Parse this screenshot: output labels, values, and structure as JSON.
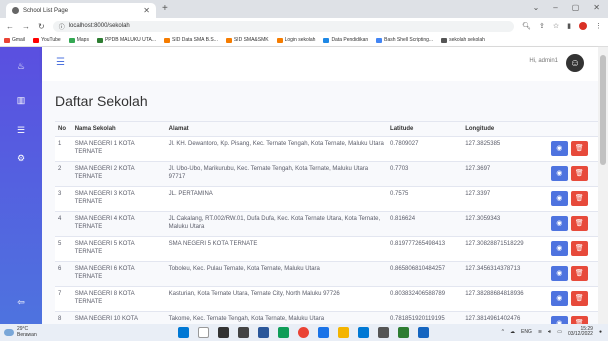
{
  "browser": {
    "tab_title": "School List Page",
    "url": "localhost:8000/sekolah",
    "bookmarks": [
      "Gmail",
      "YouTube",
      "Maps",
      "PPDB MALUKU UTA...",
      "SID Data SMA B.S...",
      "SID SMA&SMK",
      "Login sekolah",
      "Data Pendidikan",
      "Bash Shell Scripting...",
      "sekolah sekolah"
    ]
  },
  "app": {
    "user_name": "Hi, admin1",
    "page_title": "Daftar Sekolah"
  },
  "table": {
    "headers": {
      "no": "No",
      "nama": "Nama Sekolah",
      "alamat": "Alamat",
      "lat": "Latitude",
      "lon": "Longitude"
    },
    "rows": [
      {
        "no": "1",
        "nama": "SMA NEGERI 1 KOTA TERNATE",
        "alamat": "Jl. KH. Dewantoro, Kp. Pisang, Kec. Ternate Tengah, Kota Ternate, Maluku Utara",
        "lat": "0.7809027",
        "lon": "127.3825385"
      },
      {
        "no": "2",
        "nama": "SMA NEGERI 2 KOTA TERNATE",
        "alamat": "Jl. Ubo-Ubo, Marikurubu, Kec. Ternate Tengah, Kota Ternate, Maluku Utara 97717",
        "lat": "0.7703",
        "lon": "127.3697"
      },
      {
        "no": "3",
        "nama": "SMA NEGERI 3 KOTA TERNATE",
        "alamat": "JL. PERTAMINA",
        "lat": "0.7575",
        "lon": "127.3397"
      },
      {
        "no": "4",
        "nama": "SMA NEGERI 4 KOTA TERNATE",
        "alamat": "JL Cakalang, RT.002/RW.01, Dufa Dufa, Kec. Kota Ternate Utara, Kota Ternate, Maluku Utara",
        "lat": "0.816624",
        "lon": "127.3059343"
      },
      {
        "no": "5",
        "nama": "SMA NEGERI 5 KOTA TERNATE",
        "alamat": "SMA NEGERI 5 KOTA TERNATE",
        "lat": "0.819777265498413",
        "lon": "127.30828871518229"
      },
      {
        "no": "6",
        "nama": "SMA NEGERI 6 KOTA TERNATE",
        "alamat": "Toboleu, Kec. Pulau Ternate, Kota Ternate, Maluku Utara",
        "lat": "0.865806810484257",
        "lon": "127.3456314378713"
      },
      {
        "no": "7",
        "nama": "SMA NEGERI 8 KOTA TERNATE",
        "alamat": "Kasturian, Kota Ternate Utara, Ternate City, North Maluku 97726",
        "lat": "0.803832406588789",
        "lon": "127.38288684818936"
      },
      {
        "no": "8",
        "nama": "SMA NEGERI 10 KOTA TERNATE",
        "alamat": "Takome, Kec. Ternate Tengah, Kota Ternate, Maluku Utara",
        "lat": "0.781851920119195",
        "lon": "127.3814961402476"
      }
    ]
  },
  "taskbar": {
    "temperature": "29°C",
    "weather": "Berawan",
    "lang": "ENG",
    "time": "15:29",
    "date": "03/12/2022"
  },
  "colors": {
    "sidebar": "#4e73df",
    "edit": "#4e73df",
    "delete": "#e74a3b"
  }
}
